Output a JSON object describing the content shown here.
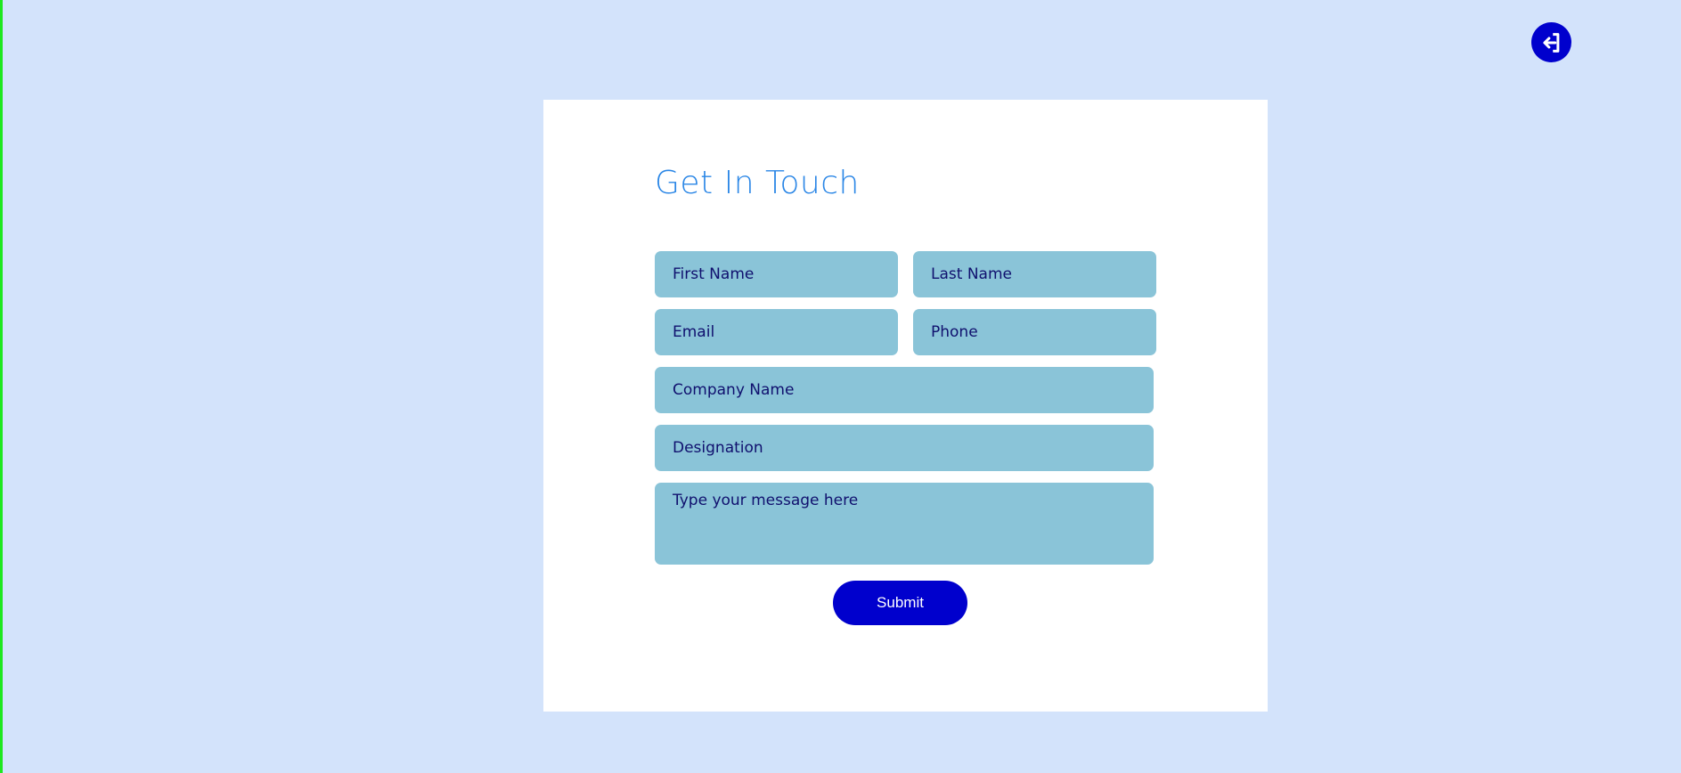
{
  "header": {
    "logout_icon": "logout-icon"
  },
  "form": {
    "title": "Get In Touch",
    "fields": {
      "first_name": {
        "placeholder": "First Name",
        "value": ""
      },
      "last_name": {
        "placeholder": "Last Name",
        "value": ""
      },
      "email": {
        "placeholder": "Email",
        "value": ""
      },
      "phone": {
        "placeholder": "Phone",
        "value": ""
      },
      "company_name": {
        "placeholder": "Company Name",
        "value": ""
      },
      "designation": {
        "placeholder": "Designation",
        "value": ""
      },
      "message": {
        "placeholder": "Type your message here",
        "value": ""
      }
    },
    "submit_label": "Submit"
  },
  "colors": {
    "page_background": "#d3e3fb",
    "card_background": "#ffffff",
    "title": "#2a86e6",
    "field_background": "#8ac4d8",
    "field_text": "#10106e",
    "accent": "#0000cd",
    "left_edge": "#1ee81e"
  }
}
